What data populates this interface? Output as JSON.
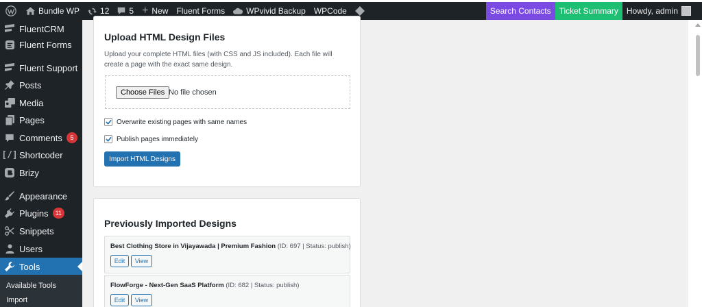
{
  "adminbar": {
    "site_name": "Bundle WP",
    "updates_count": "12",
    "comments_count": "5",
    "new_label": "New",
    "fluent_forms": "Fluent Forms",
    "wpvivid": "WPvivid Backup",
    "wpcode": "WPCode",
    "search_contacts": "Search Contacts",
    "ticket_summary": "Ticket Summary",
    "howdy": "Howdy, admin",
    "colors": {
      "bar": "#1d2327",
      "search_contacts_bg": "#7b4ae2",
      "ticket_summary_bg": "#1fbf73"
    }
  },
  "sidebar": {
    "items": [
      {
        "label": "FluentCRM",
        "icon": "fluentcrm-icon"
      },
      {
        "label": "Fluent Forms",
        "icon": "fluent-forms-icon"
      },
      {
        "label": "Fluent Support",
        "icon": "fluent-support-icon"
      },
      {
        "label": "Posts",
        "icon": "pushpin-icon"
      },
      {
        "label": "Media",
        "icon": "media-icon"
      },
      {
        "label": "Pages",
        "icon": "pages-icon"
      },
      {
        "label": "Comments",
        "icon": "comments-icon",
        "badge": "5"
      },
      {
        "label": "Shortcoder",
        "icon": "shortcoder-icon"
      },
      {
        "label": "Brizy",
        "icon": "brizy-icon"
      },
      {
        "label": "Appearance",
        "icon": "paintbrush-icon"
      },
      {
        "label": "Plugins",
        "icon": "plugins-icon",
        "badge": "11"
      },
      {
        "label": "Snippets",
        "icon": "scissors-icon"
      },
      {
        "label": "Users",
        "icon": "users-icon"
      },
      {
        "label": "Tools",
        "icon": "wrench-icon",
        "current": true
      }
    ],
    "submenu": [
      "Available Tools",
      "Import"
    ],
    "colors": {
      "active": "#2271b1",
      "badge": "#d63638"
    }
  },
  "upload_card": {
    "title": "Upload HTML Design Files",
    "description": "Upload your complete HTML files (with CSS and JS included). Each file will create a page with the exact same design.",
    "choose_files": "Choose Files",
    "no_file": "No file chosen",
    "overwrite_label": "Overwrite existing pages with same names",
    "overwrite_checked": true,
    "publish_label": "Publish pages immediately",
    "publish_checked": true,
    "import_button": "Import HTML Designs"
  },
  "designs_card": {
    "title": "Previously Imported Designs",
    "designs": [
      {
        "name": "Best Clothing Store in Vijayawada | Premium Fashion",
        "meta": "(ID: 697 | Status: publish)",
        "edit": "Edit",
        "view": "View"
      },
      {
        "name": "FlowForge - Next-Gen SaaS Platform",
        "meta": "(ID: 682 | Status: publish)",
        "edit": "Edit",
        "view": "View"
      }
    ]
  }
}
